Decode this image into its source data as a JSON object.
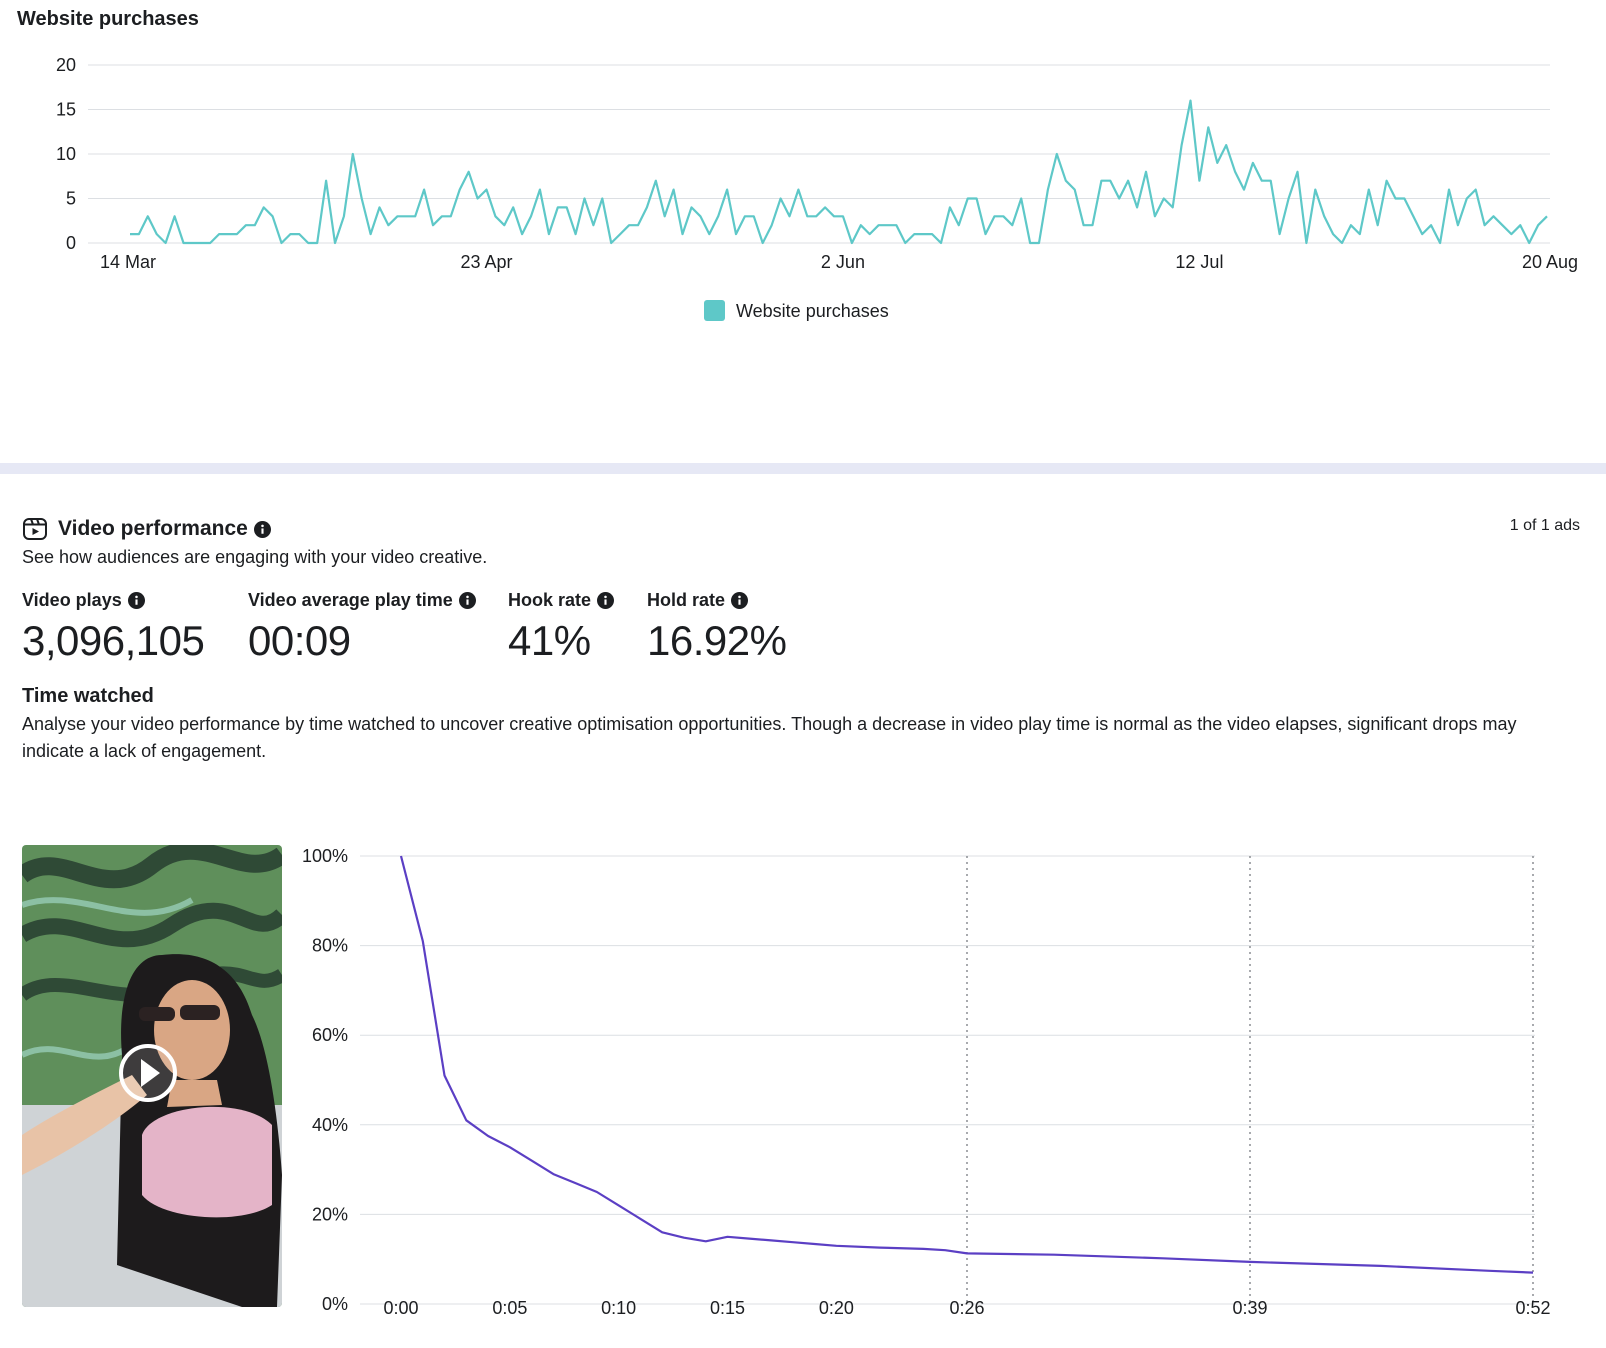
{
  "purchases": {
    "title": "Website purchases",
    "legend_label": "Website purchases",
    "color": "#5ec8c8"
  },
  "video_performance": {
    "title": "Video performance",
    "ads_count": "1 of 1 ads",
    "subtitle": "See how audiences are engaging with your video creative.",
    "metrics": [
      {
        "label": "Video plays",
        "value": "3,096,105"
      },
      {
        "label": "Video average play time",
        "value": "00:09"
      },
      {
        "label": "Hook rate",
        "value": "41%"
      },
      {
        "label": "Hold rate",
        "value": "16.92%"
      }
    ],
    "time_watched": {
      "title": "Time watched",
      "description": "Analyse your video performance by time watched to uncover creative optimisation opportunities. Though a decrease in video play time is normal as the video elapses, significant drops may indicate a lack of engagement."
    },
    "line_color": "#5b3fc4"
  },
  "chart_data": [
    {
      "type": "line",
      "title": "Website purchases",
      "series_name": "Website purchases",
      "x_tick_labels": [
        "14 Mar",
        "23 Apr",
        "2 Jun",
        "12 Jul",
        "20 Aug"
      ],
      "x_tick_indices": [
        0,
        40,
        80,
        120,
        160
      ],
      "ylim": [
        0,
        20
      ],
      "y_ticks": [
        0,
        5,
        10,
        15,
        20
      ],
      "grid": true,
      "legend": "bottom-center",
      "values": [
        1,
        1,
        3,
        1,
        0,
        3,
        0,
        0,
        0,
        0,
        1,
        1,
        1,
        2,
        2,
        4,
        3,
        0,
        1,
        1,
        0,
        0,
        7,
        0,
        3,
        10,
        5,
        1,
        4,
        2,
        3,
        3,
        3,
        6,
        2,
        3,
        3,
        6,
        8,
        5,
        6,
        3,
        2,
        4,
        1,
        3,
        6,
        1,
        4,
        4,
        1,
        5,
        2,
        5,
        0,
        1,
        2,
        2,
        4,
        7,
        3,
        6,
        1,
        4,
        3,
        1,
        3,
        6,
        1,
        3,
        3,
        0,
        2,
        5,
        3,
        6,
        3,
        3,
        4,
        3,
        3,
        0,
        2,
        1,
        2,
        2,
        2,
        0,
        1,
        1,
        1,
        0,
        4,
        2,
        5,
        5,
        1,
        3,
        3,
        2,
        5,
        0,
        0,
        6,
        10,
        7,
        6,
        2,
        2,
        7,
        7,
        5,
        7,
        4,
        8,
        3,
        5,
        4,
        11,
        16,
        7,
        13,
        9,
        11,
        8,
        6,
        9,
        7,
        7,
        1,
        5,
        8,
        0,
        6,
        3,
        1,
        0,
        2,
        1,
        6,
        2,
        7,
        5,
        5,
        3,
        1,
        2,
        0,
        6,
        2,
        5,
        6,
        2,
        3,
        2,
        1,
        2,
        0,
        2,
        3
      ]
    },
    {
      "type": "line",
      "title": "Time watched",
      "x_tick_labels": [
        "0:00",
        "0:05",
        "0:10",
        "0:15",
        "0:20",
        "0:26",
        "0:39",
        "0:52"
      ],
      "x_tick_seconds": [
        0,
        5,
        10,
        15,
        20,
        26,
        39,
        52
      ],
      "dashed_vertical_at_seconds": [
        26,
        39,
        52
      ],
      "y_tick_labels": [
        "0%",
        "20%",
        "40%",
        "60%",
        "80%",
        "100%"
      ],
      "ylim": [
        0,
        100
      ],
      "grid": true,
      "points": [
        {
          "x": 0,
          "y": 100
        },
        {
          "x": 1,
          "y": 81
        },
        {
          "x": 2,
          "y": 51
        },
        {
          "x": 3,
          "y": 41
        },
        {
          "x": 4,
          "y": 37.5
        },
        {
          "x": 5,
          "y": 35
        },
        {
          "x": 6,
          "y": 32
        },
        {
          "x": 7,
          "y": 29
        },
        {
          "x": 8,
          "y": 27
        },
        {
          "x": 9,
          "y": 25
        },
        {
          "x": 10,
          "y": 22
        },
        {
          "x": 11,
          "y": 19
        },
        {
          "x": 12,
          "y": 16
        },
        {
          "x": 13,
          "y": 14.8
        },
        {
          "x": 14,
          "y": 14
        },
        {
          "x": 15,
          "y": 15
        },
        {
          "x": 16,
          "y": 14.6
        },
        {
          "x": 17,
          "y": 14.2
        },
        {
          "x": 18,
          "y": 13.8
        },
        {
          "x": 19,
          "y": 13.4
        },
        {
          "x": 20,
          "y": 13
        },
        {
          "x": 22,
          "y": 12.6
        },
        {
          "x": 24,
          "y": 12.3
        },
        {
          "x": 25,
          "y": 12
        },
        {
          "x": 26,
          "y": 11.3
        },
        {
          "x": 30,
          "y": 11
        },
        {
          "x": 35,
          "y": 10.2
        },
        {
          "x": 39,
          "y": 9.4
        },
        {
          "x": 45,
          "y": 8.5
        },
        {
          "x": 50,
          "y": 7.4
        },
        {
          "x": 52,
          "y": 7
        }
      ]
    }
  ]
}
